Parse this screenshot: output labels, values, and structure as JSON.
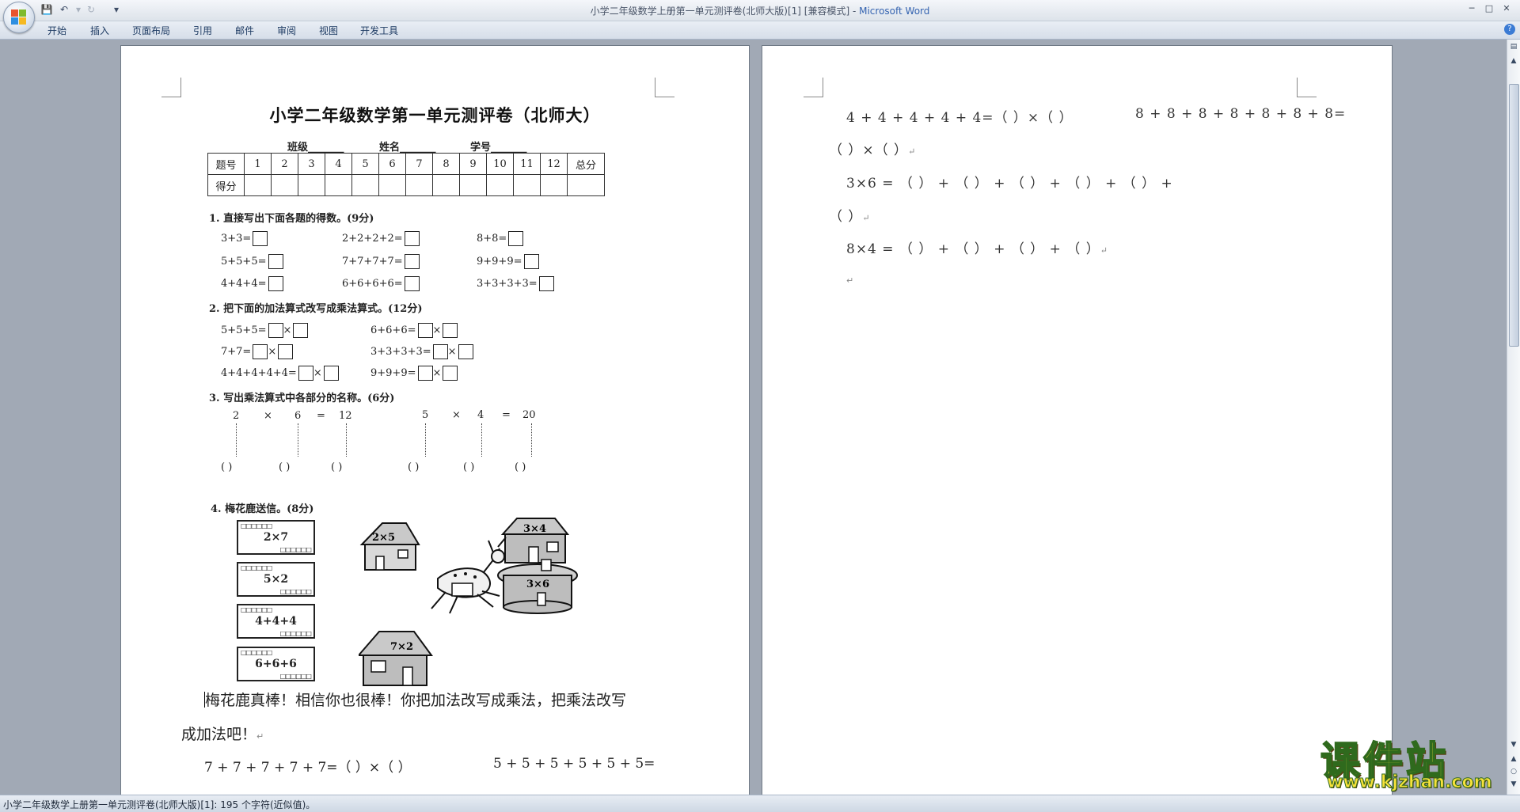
{
  "window": {
    "title": "小学二年级数学上册第一单元测评卷(北师大版)[1] [兼容模式]",
    "app_name": "Microsoft Word",
    "title_sep": " - "
  },
  "quick_access": [
    "save-icon",
    "undo-icon",
    "redo-icon",
    "customize-icon"
  ],
  "ribbon_tabs": [
    "开始",
    "插入",
    "页面布局",
    "引用",
    "邮件",
    "审阅",
    "视图",
    "开发工具"
  ],
  "page1": {
    "title": "小学二年级数学第一单元测评卷（北师大）",
    "info": {
      "class": "班级_______",
      "name": "姓名_______",
      "number": "学号_______"
    },
    "score_table": {
      "row1": [
        "题号",
        "1",
        "2",
        "3",
        "4",
        "5",
        "6",
        "7",
        "8",
        "9",
        "10",
        "11",
        "12",
        "总分"
      ],
      "row2_label": "得分"
    },
    "q1": {
      "title": "1. 直接写出下面各题的得数。(9分)",
      "items": [
        "3+3=",
        "2+2+2+2=",
        "8+8=",
        "5+5+5=",
        "7+7+7+7=",
        "9+9+9=",
        "4+4+4=",
        "6+6+6+6=",
        "3+3+3+3="
      ]
    },
    "q2": {
      "title": "2. 把下面的加法算式改写成乘法算式。(12分)",
      "items": [
        "5+5+5=",
        "6+6+6=",
        "7+7=",
        "3+3+3+3=",
        "4+4+4+4+4=",
        "9+9+9="
      ],
      "times": "×"
    },
    "q3": {
      "title": "3. 写出乘法算式中各部分的名称。(6分)",
      "eq1": [
        "2",
        "×",
        "6",
        "=",
        "12"
      ],
      "eq2": [
        "5",
        "×",
        "4",
        "=",
        "20"
      ],
      "paren": "(      )"
    },
    "q4": {
      "title": "4. 梅花鹿送信。(8分)",
      "envelopes": [
        "2×7",
        "5×2",
        "4+4+4",
        "6+6+6"
      ],
      "stamp_marks": "□□□□□□",
      "houses": [
        "2×5",
        "3×4",
        "3×6",
        "7×2"
      ]
    },
    "paragraph_line1": "梅花鹿真棒！相信你也很棒！你把加法改写成乘法，把乘法改写",
    "paragraph_line2": "成加法吧！",
    "eq_line_a": "7 + 7 + 7 + 7 + 7=（     ）×（     ）",
    "eq_line_b": "5 + 5 + 5 + 5 + 5 + 5="
  },
  "page2": {
    "line1a": "4 + 4 + 4 + 4 + 4=（     ）×（     ）",
    "line1b": "8 + 8 + 8 + 8 + 8 + 8 + 8=",
    "line2": "（     ）×（     ）",
    "line3": "3×6 = （       ） + （       ） + （       ） + （       ） + （       ） +",
    "line4": "（       ）",
    "line5": "8×4 = （       ） + （       ） + （       ） + （       ）"
  },
  "status": {
    "text": "小学二年级数学上册第一单元测评卷(北师大版)[1]: 195 个字符(近似值)。"
  },
  "watermark": {
    "main": "课件站",
    "url": "www.kjzhan.com"
  },
  "colors": {
    "app_name": "#3463b0",
    "watermark_fill": "#f7e13a",
    "watermark_stroke": "#2f6a1d"
  }
}
